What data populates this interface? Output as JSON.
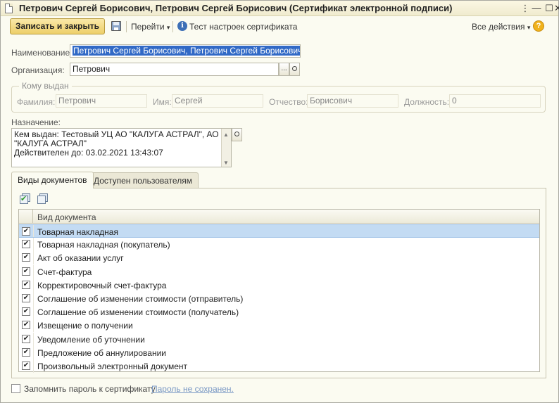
{
  "window": {
    "title": "Петрович Сергей Борисович, Петрович Сергей Борисович (Сертификат электронной подписи)",
    "controls": {
      "more": "⋮",
      "minimize": "—",
      "maximize": "☐",
      "close": "✕"
    }
  },
  "toolbar": {
    "save_close": "Записать и закрыть",
    "goto": "Перейти",
    "goto_arrow": "▾",
    "test_settings": "Тест настроек сертификата",
    "all_actions": "Все действия",
    "all_actions_arrow": "▾",
    "help": "?"
  },
  "form": {
    "name_label": "Наименование:",
    "name_value": "Петрович Сергей Борисович, Петрович Сергей Борисович",
    "org_label": "Организация:",
    "org_value": "Петрович",
    "org_choose": "...",
    "issued_to": {
      "title": "Кому выдан",
      "surname_label": "Фамилия:",
      "surname_value": "Петрович",
      "name_label": "Имя:",
      "name_value": "Сергей",
      "patronymic_label": "Отчество:",
      "patronymic_value": "Борисович",
      "position_label": "Должность:",
      "position_value": "0"
    },
    "purpose_label": "Назначение:",
    "purpose_lines": [
      "Кем выдан: Тестовый УЦ АО \"КАЛУГА АСТРАЛ\", АО",
      "\"КАЛУГА АСТРАЛ\"",
      "Действителен до: 03.02.2021 13:43:07"
    ]
  },
  "tabs": [
    {
      "label": "Виды документов",
      "active": true
    },
    {
      "label": "Доступен пользователям",
      "active": false
    }
  ],
  "doc_table": {
    "column_header": "Вид документа",
    "rows": [
      {
        "label": "Товарная накладная",
        "checked": true,
        "selected": true
      },
      {
        "label": "Товарная накладная (покупатель)",
        "checked": true
      },
      {
        "label": "Акт об оказании услуг",
        "checked": true
      },
      {
        "label": "Счет-фактура",
        "checked": true
      },
      {
        "label": "Корректировочный счет-фактура",
        "checked": true
      },
      {
        "label": "Соглашение об изменении стоимости (отправитель)",
        "checked": true
      },
      {
        "label": "Соглашение об изменении стоимости (получатель)",
        "checked": true
      },
      {
        "label": "Извещение о получении",
        "checked": true
      },
      {
        "label": "Уведомление об уточнении",
        "checked": true
      },
      {
        "label": "Предложение об аннулировании",
        "checked": true
      },
      {
        "label": "Произвольный электронный документ",
        "checked": true
      }
    ]
  },
  "footer": {
    "remember_password": "Запомнить пароль к сертификату",
    "password_status": "Пароль не сохранен."
  },
  "icons": {
    "check_mark": "✔",
    "scroll_up": "▲",
    "scroll_down": "▼"
  }
}
